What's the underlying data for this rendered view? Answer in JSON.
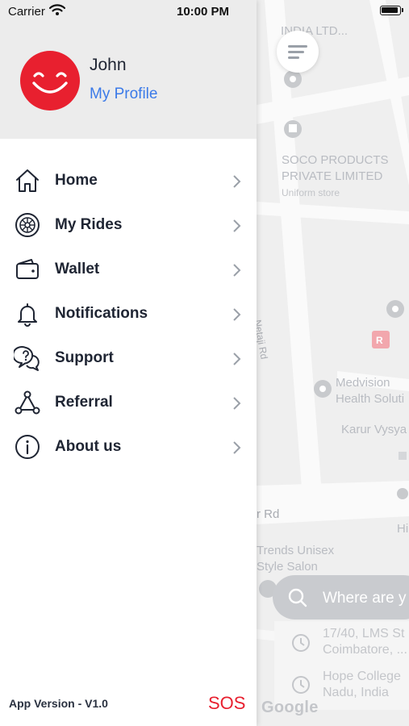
{
  "status_bar": {
    "carrier": "Carrier",
    "time": "10:00 PM"
  },
  "profile": {
    "name": "John",
    "link_label": "My Profile",
    "avatar_color": "#e8202f"
  },
  "menu": {
    "items": [
      {
        "label": "Home",
        "icon": "home-icon"
      },
      {
        "label": "My Rides",
        "icon": "wheel-icon"
      },
      {
        "label": "Wallet",
        "icon": "wallet-icon"
      },
      {
        "label": "Notifications",
        "icon": "bell-icon"
      },
      {
        "label": "Support",
        "icon": "support-chat-icon"
      },
      {
        "label": "Referral",
        "icon": "share-nodes-icon"
      },
      {
        "label": "About us",
        "icon": "info-icon"
      }
    ]
  },
  "footer": {
    "version": "App Version - V1.0",
    "sos_label": "SOS"
  },
  "map": {
    "labels": {
      "india_ltd": "INDIA LTD...",
      "soco_line1": "SOCO PRODUCTS",
      "soco_line2": "PRIVATE LIMITED",
      "soco_sub": "Uniform store",
      "netaji": "Netaji Rd",
      "medvision_line1": "Medvision",
      "medvision_line2": "Health Soluti",
      "karur": "Karur Vysya",
      "road": "r Rd",
      "hi": "Hi",
      "trends_line1": "Trends Unisex",
      "trends_line2": "Style Salon",
      "google": "Google"
    },
    "search_placeholder": "Where are y",
    "recent": [
      {
        "line1": "17/40, LMS St",
        "line2": "Coimbatore, ..."
      },
      {
        "line1": "Hope College",
        "line2": "Nadu, India"
      }
    ]
  },
  "colors": {
    "accent": "#e8202f",
    "link": "#3b7ae8",
    "text": "#1f2533"
  }
}
